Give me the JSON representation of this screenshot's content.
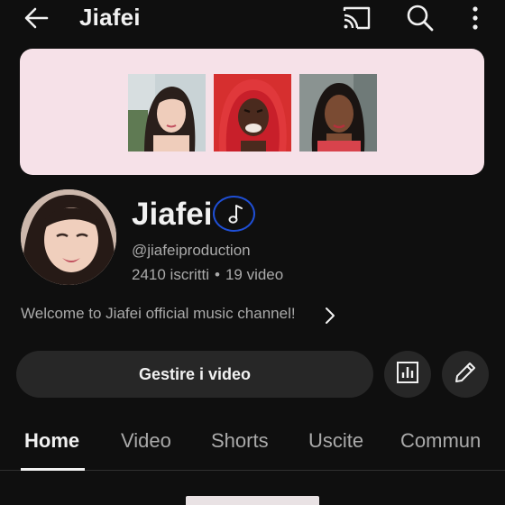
{
  "topbar": {
    "title": "Jiafei",
    "icons": [
      "back-arrow-icon",
      "cast-icon",
      "search-icon",
      "more-vert-icon"
    ]
  },
  "banner": {
    "background": "#f6e1e8",
    "thumbnails": [
      "photo",
      "photo",
      "photo"
    ]
  },
  "channel": {
    "name": "Jiafei",
    "badge_icon": "music-note-icon",
    "handle": "@jiafeiproduction",
    "subscribers": "2410 iscritti",
    "separator": "•",
    "videos": "19 video",
    "description": "Welcome to Jiafei official music channel!"
  },
  "actions": {
    "manage_label": "Gestire i video",
    "analytics_icon": "analytics-icon",
    "edit_icon": "edit-pencil-icon"
  },
  "tabs": [
    {
      "label": "Home",
      "active": true
    },
    {
      "label": "Video",
      "active": false
    },
    {
      "label": "Shorts",
      "active": false
    },
    {
      "label": "Uscite",
      "active": false
    },
    {
      "label": "Commun",
      "active": false
    }
  ],
  "colors": {
    "background": "#0f0f0f",
    "text_primary": "#f1f1f1",
    "text_secondary": "#aaaaaa",
    "button_bg": "#272727",
    "badge_outline": "#1f4fd6"
  }
}
